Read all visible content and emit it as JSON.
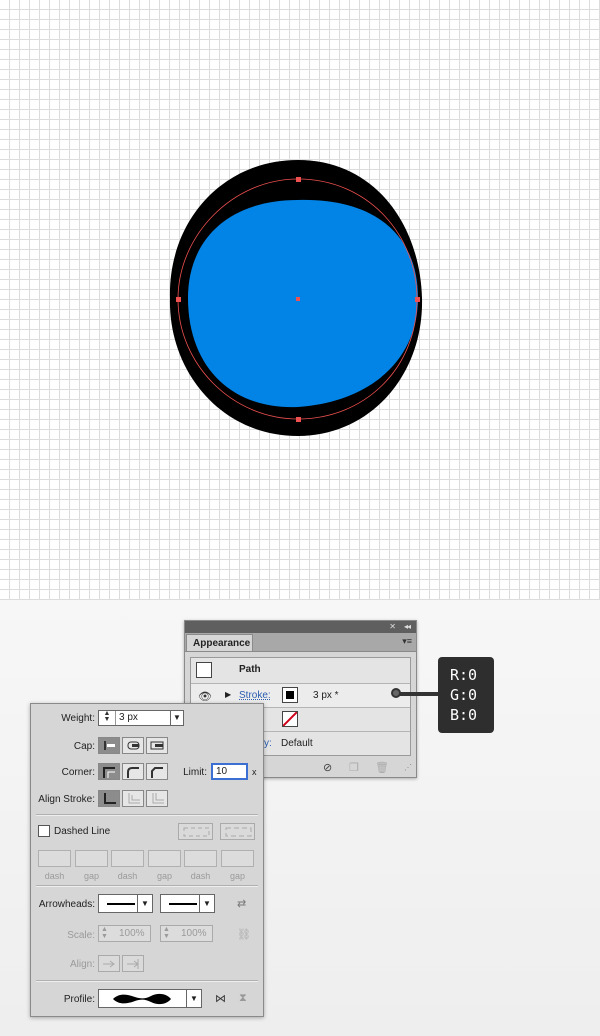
{
  "artboard": {
    "shape_fill": "#0283e6",
    "stroke_color": "#000000",
    "path_color": "#f05050"
  },
  "appearance_panel": {
    "tab_label": "Appearance",
    "collapse_glyph": "◂◂",
    "menu_glyph": "▾≡",
    "object_label": "Path",
    "stroke_link": "Stroke:",
    "stroke_value": "3 px *",
    "opacity_link": "ity:",
    "opacity_value": "Default",
    "bottom_icons": [
      "clear-appearance-icon",
      "duplicate-item-icon",
      "delete-item-icon"
    ]
  },
  "callout": {
    "line1": "R:0",
    "line2": "G:0",
    "line3": "B:0"
  },
  "stroke_panel": {
    "weight_label": "Weight:",
    "weight_value": "3 px",
    "cap_label": "Cap:",
    "corner_label": "Corner:",
    "limit_label": "Limit:",
    "limit_value": "10",
    "limit_unit": "x",
    "align_label": "Align Stroke:",
    "dashed_label": "Dashed Line",
    "dash_labels": [
      "dash",
      "gap",
      "dash",
      "gap",
      "dash",
      "gap"
    ],
    "arrowheads_label": "Arrowheads:",
    "scale_label": "Scale:",
    "scale_start": "100%",
    "scale_end": "100%",
    "align_arrow_label": "Align:",
    "profile_label": "Profile:"
  }
}
